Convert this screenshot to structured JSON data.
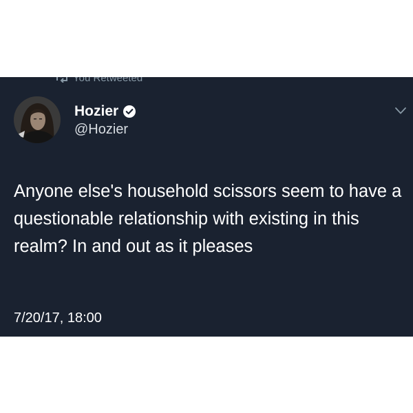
{
  "header": {
    "retweet_label": "You Retweeted"
  },
  "tweet": {
    "author_name": "Hozier",
    "author_handle": "@Hozier",
    "verified": true,
    "text": "Anyone else's household scissors seem to have a questionable relationship with existing in this realm? In and out as it pleases",
    "timestamp": "7/20/17, 18:00"
  },
  "icons": {
    "retweet": "retweet-icon",
    "verified": "verified-badge-icon",
    "menu": "chevron-down-icon",
    "avatar": "avatar"
  },
  "colors": {
    "background": "#1a2230",
    "text": "#ffffff",
    "muted": "#8899a6",
    "verified_badge": "#ffffff"
  }
}
